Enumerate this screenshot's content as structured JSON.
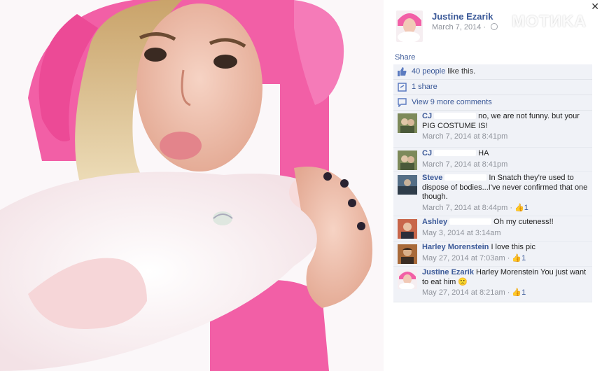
{
  "watermark": "MOTИKA",
  "post": {
    "author": "Justine Ezarik",
    "date": "March 7, 2014 · ",
    "share_label": "Share",
    "likes_text": "40 people",
    "likes_suffix": " like this.",
    "shares_text": "1 share",
    "more_comments": "View 9 more comments"
  },
  "comments": [
    {
      "author": "CJ",
      "text": "no, we are not funny. but your PIG COSTUME IS!",
      "time": "March 7, 2014 at 8:41pm",
      "likes": ""
    },
    {
      "author": "CJ",
      "text": "HA",
      "time": "March 7, 2014 at 8:41pm",
      "likes": ""
    },
    {
      "author": "Steve",
      "text": "In Snatch they're used to dispose of bodies...I've never confirmed that one though.",
      "time": "March 7, 2014 at 8:44pm · ",
      "likes": "1"
    },
    {
      "author": "Ashley",
      "text": "Oh my cuteness!!",
      "time": "May 3, 2014 at 3:14am",
      "likes": ""
    },
    {
      "author": "Harley Morenstein",
      "text": "I love this pic",
      "time": "May 27, 2014 at 7:03am · ",
      "likes": "1"
    },
    {
      "author": "Justine Ezarik",
      "text": "Harley Morenstein You just want to eat him 🙁",
      "time": "May 27, 2014 at 8:21am · ",
      "likes": "1"
    }
  ],
  "colors": {
    "link": "#3b5998",
    "panel_bg": "#f0f2f7",
    "costume_pink": "#f25fa6"
  }
}
